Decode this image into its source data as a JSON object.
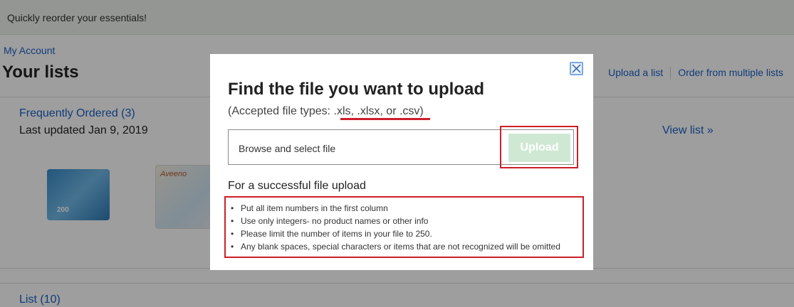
{
  "banner": {
    "text": "Quickly reorder your essentials!"
  },
  "breadcrumb": {
    "my_account": "My Account"
  },
  "page_title": "Your lists",
  "header_links": {
    "upload_list": "Upload a list",
    "order_multiple": "Order from multiple lists"
  },
  "lists": [
    {
      "title": "Frequently Ordered (3)",
      "updated": "Last updated Jan 9, 2019",
      "view_link": "View list »",
      "product_labels": [
        "200",
        "Aveeno"
      ]
    },
    {
      "title": "List (10)"
    }
  ],
  "modal": {
    "title": "Find the file you want to upload",
    "accepted_prefix": "(Accepted file types: ",
    "accepted_types": ".xls, .xlsx, or .csv",
    "accepted_suffix": ")",
    "file_placeholder": "Browse and select file",
    "upload_label": "Upload",
    "success_title": "For a successful file upload",
    "rules": [
      "Put all item numbers in the first column",
      "Use only integers- no product names or other info",
      "Please limit the number of items in your file to 250.",
      "Any blank spaces, special characters or items that are not recognized will be omitted"
    ],
    "close_icon": "close-icon"
  },
  "colors": {
    "link": "#1a62c6",
    "highlight": "#cc1f2a",
    "upload_button": "#cfe8d3",
    "overlay": "rgba(0,0,0,0.38)"
  }
}
